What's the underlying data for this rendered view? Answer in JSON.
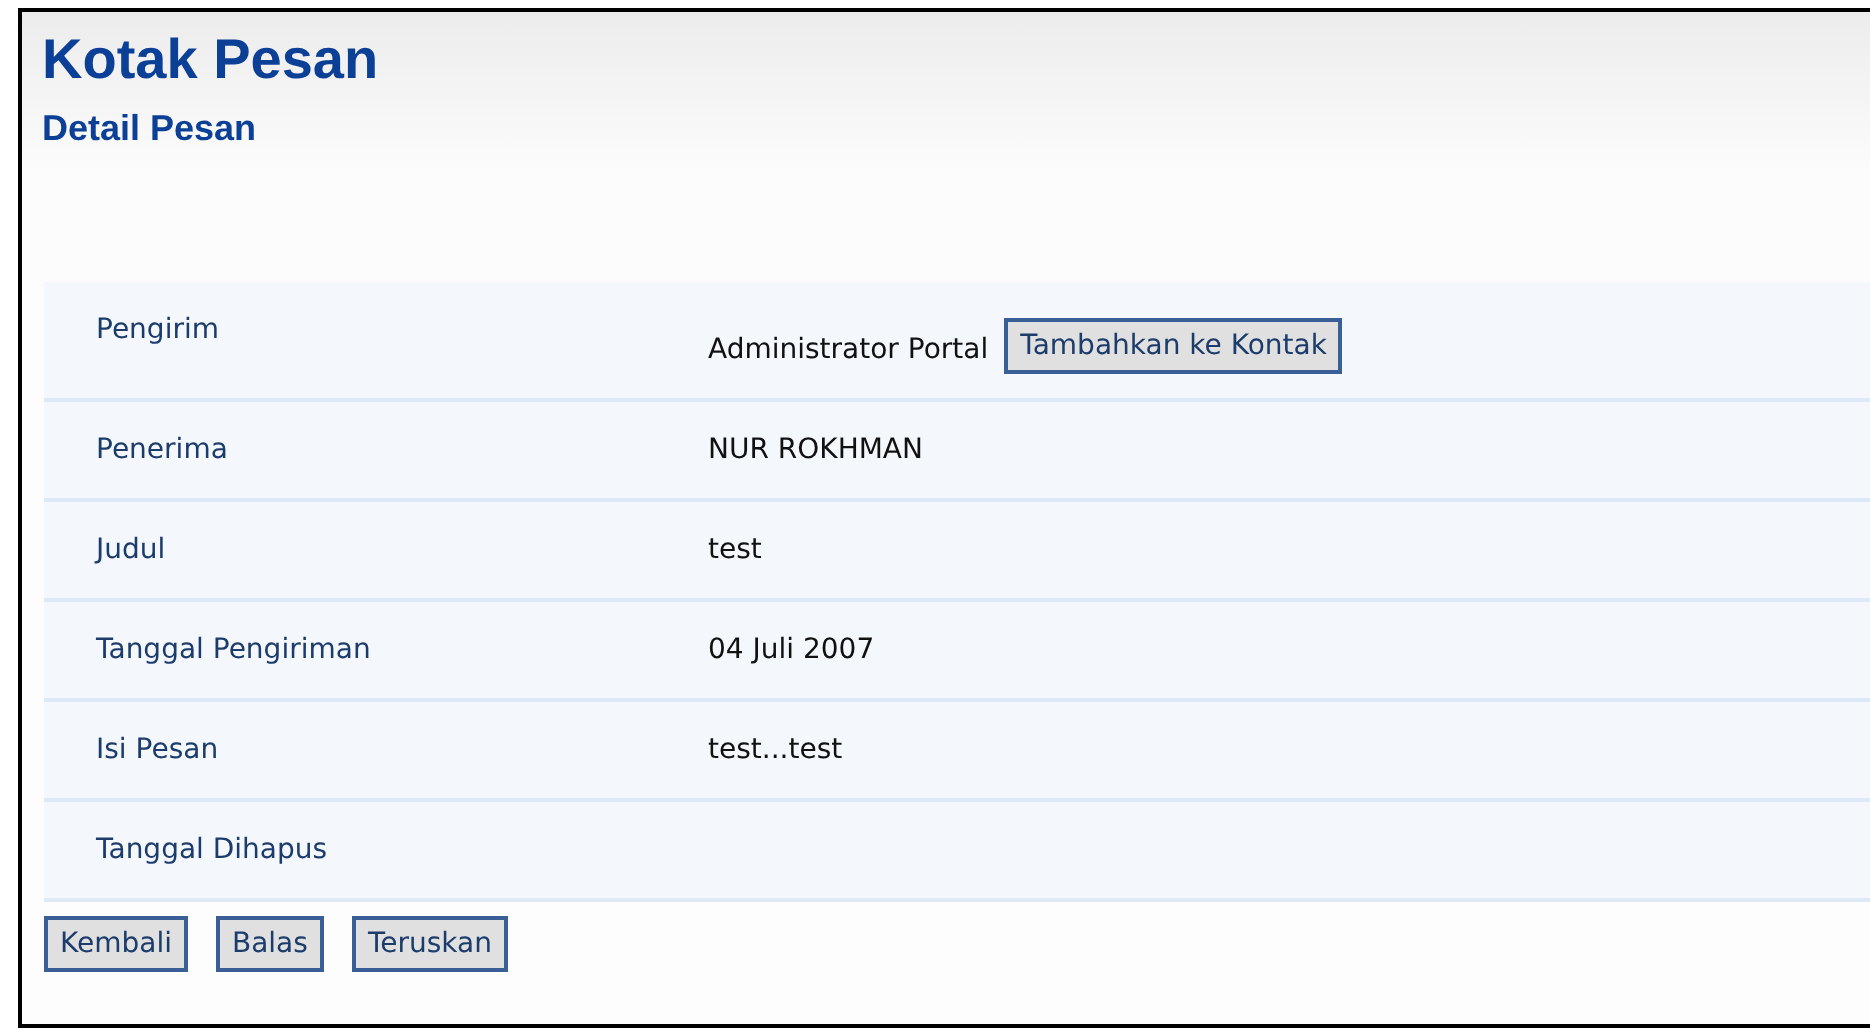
{
  "title": "Kotak Pesan",
  "subtitle": "Detail Pesan",
  "rows": [
    {
      "label": "Pengirim",
      "value": "Administrator Portal",
      "button": "Tambahkan ke Kontak"
    },
    {
      "label": "Penerima",
      "value": "NUR ROKHMAN"
    },
    {
      "label": "Judul",
      "value": "test"
    },
    {
      "label": "Tanggal Pengiriman",
      "value": "04 Juli 2007"
    },
    {
      "label": "Isi Pesan",
      "value": "test...test"
    },
    {
      "label": "Tanggal Dihapus"
    }
  ],
  "buttons": [
    "Kembali",
    "Balas",
    "Teruskan"
  ]
}
